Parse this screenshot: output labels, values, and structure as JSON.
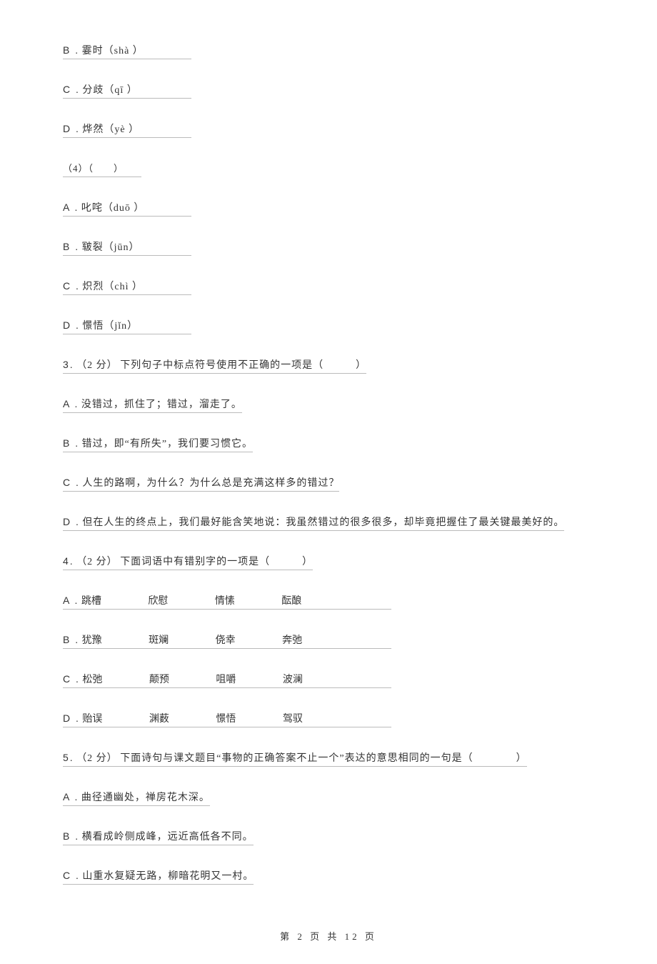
{
  "options_set1": [
    {
      "label": "B .",
      "text": "霎时（shà ）"
    },
    {
      "label": "C .",
      "text": "分歧（qī ）"
    },
    {
      "label": "D .",
      "text": "烨然（yè ）"
    }
  ],
  "sub_q4": "（4）（　　）",
  "options_set2": [
    {
      "label": "A .",
      "text": "叱咤（duō ）"
    },
    {
      "label": "B .",
      "text": "皲裂（jūn）"
    },
    {
      "label": "C .",
      "text": "炽烈（chì ）"
    },
    {
      "label": "D .",
      "text": "憬悟（jǐn）"
    }
  ],
  "q3": {
    "num": "3.",
    "score": "（2 分）",
    "text": "下列句子中标点符号使用不正确的一项是（　　　）",
    "options": [
      {
        "label": "A .",
        "text": "没错过，抓住了；错过，溜走了。"
      },
      {
        "label": "B .",
        "text": "错过，即“有所失”，我们要习惯它。"
      },
      {
        "label": "C .",
        "text": "人生的路啊，为什么？为什么总是充满这样多的错过？"
      },
      {
        "label": "D .",
        "text": "但在人生的终点上，我们最好能含笑地说：我虽然错过的很多很多，却毕竟把握住了最关键最美好的。"
      }
    ]
  },
  "q4": {
    "num": "4.",
    "score": "（2 分）",
    "text": "下面词语中有错别字的一项是（　　　）",
    "options": [
      {
        "label": "A .",
        "words": [
          "跳槽",
          "欣慰",
          "情愫",
          "酝酿"
        ]
      },
      {
        "label": "B .",
        "words": [
          "犹豫",
          "斑斓",
          "侥幸",
          "奔弛"
        ]
      },
      {
        "label": "C .",
        "words": [
          "松弛",
          "颠预",
          "咀嚼",
          "波澜"
        ]
      },
      {
        "label": "D .",
        "words": [
          "贻误",
          "渊薮",
          "憬悟",
          "驾驭"
        ]
      }
    ]
  },
  "q5": {
    "num": "5.",
    "score": "（2 分）",
    "text": "下面诗句与课文题目“事物的正确答案不止一个”表达的意思相同的一句是（　　　　）",
    "options": [
      {
        "label": "A .",
        "text": "曲径通幽处，禅房花木深。"
      },
      {
        "label": "B .",
        "text": "横看成岭侧成峰，远近高低各不同。"
      },
      {
        "label": "C .",
        "text": "山重水复疑无路，柳暗花明又一村。"
      }
    ]
  },
  "footer": "第 2 页 共 12 页"
}
